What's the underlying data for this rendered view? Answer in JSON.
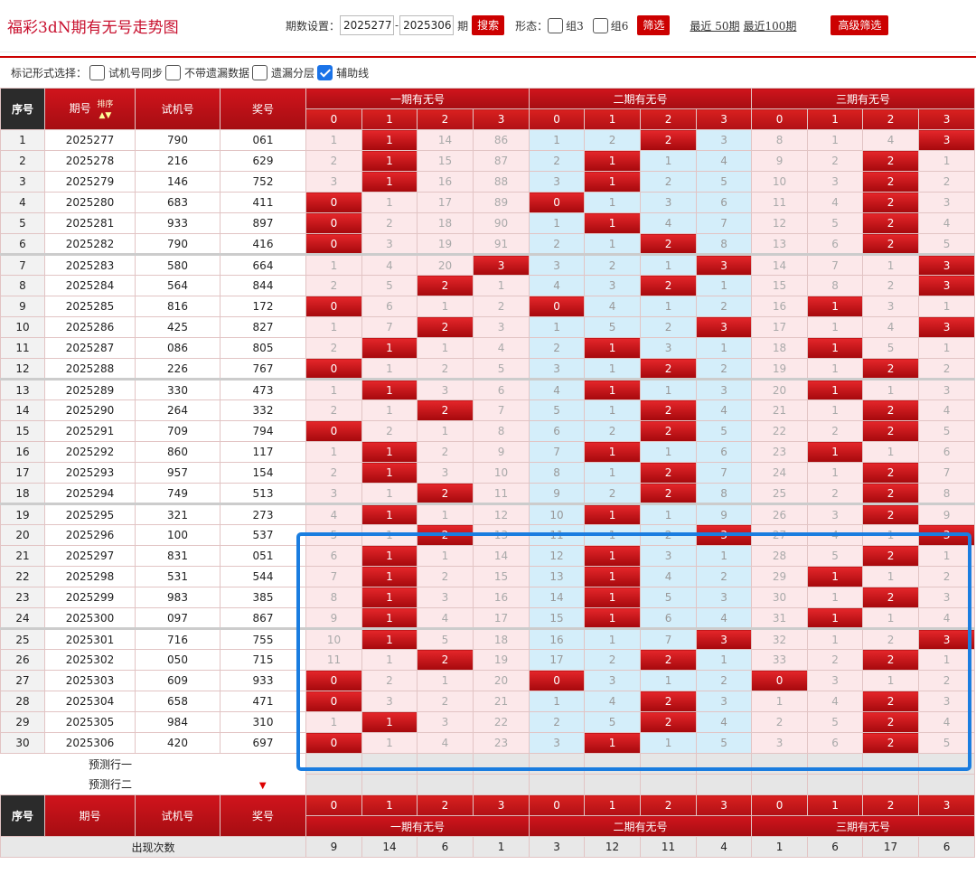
{
  "title": "福彩3dN期有无号走势图",
  "controls": {
    "period_label": "期数设置：",
    "from_value": "2025277",
    "dash": "-",
    "to_value": "2025306",
    "period_unit": "期",
    "search_label": "搜索",
    "form_label": "形态：",
    "group3_label": "组3",
    "group6_label": "组6",
    "filter_label": "筛选",
    "recent50_label": "最近 50期",
    "recent100_label": "最近100期",
    "advanced_label": "高级筛选"
  },
  "markbar": {
    "label": "标记形式选择：",
    "options": [
      {
        "label": "试机号同步",
        "checked": false
      },
      {
        "label": "不带遗漏数据",
        "checked": false
      },
      {
        "label": "遗漏分层",
        "checked": false
      },
      {
        "label": "辅助线",
        "checked": true
      }
    ]
  },
  "header": {
    "seq": "序号",
    "issue": "期号",
    "sort": "排序",
    "trial": "试机号",
    "prize": "奖号",
    "groups": [
      "一期有无号",
      "二期有无号",
      "三期有无号"
    ],
    "digits": [
      "0",
      "1",
      "2",
      "3"
    ]
  },
  "rows": [
    {
      "seq": "1",
      "issue": "2025277",
      "trial": "790",
      "prize": "061",
      "g": [
        [
          "1",
          "h1",
          "14",
          "86"
        ],
        [
          "1",
          "2",
          "h2",
          "3"
        ],
        [
          "8",
          "1",
          "4",
          "h3"
        ]
      ]
    },
    {
      "seq": "2",
      "issue": "2025278",
      "trial": "216",
      "prize": "629",
      "g": [
        [
          "2",
          "h1",
          "15",
          "87"
        ],
        [
          "2",
          "h1",
          "1",
          "4"
        ],
        [
          "9",
          "2",
          "h2",
          "1"
        ]
      ]
    },
    {
      "seq": "3",
      "issue": "2025279",
      "trial": "146",
      "prize": "752",
      "g": [
        [
          "3",
          "h1",
          "16",
          "88"
        ],
        [
          "3",
          "h1",
          "2",
          "5"
        ],
        [
          "10",
          "3",
          "h2",
          "2"
        ]
      ]
    },
    {
      "seq": "4",
      "issue": "2025280",
      "trial": "683",
      "prize": "411",
      "g": [
        [
          "h0",
          "1",
          "17",
          "89"
        ],
        [
          "h0",
          "1",
          "3",
          "6"
        ],
        [
          "11",
          "4",
          "h2",
          "3"
        ]
      ]
    },
    {
      "seq": "5",
      "issue": "2025281",
      "trial": "933",
      "prize": "897",
      "g": [
        [
          "h0",
          "2",
          "18",
          "90"
        ],
        [
          "1",
          "h1",
          "4",
          "7"
        ],
        [
          "12",
          "5",
          "h2",
          "4"
        ]
      ]
    },
    {
      "seq": "6",
      "issue": "2025282",
      "trial": "790",
      "prize": "416",
      "g": [
        [
          "h0",
          "3",
          "19",
          "91"
        ],
        [
          "2",
          "1",
          "h2",
          "8"
        ],
        [
          "13",
          "6",
          "h2",
          "5"
        ]
      ]
    },
    {
      "seq": "7",
      "issue": "2025283",
      "trial": "580",
      "prize": "664",
      "g": [
        [
          "1",
          "4",
          "20",
          "h3"
        ],
        [
          "3",
          "2",
          "1",
          "h3"
        ],
        [
          "14",
          "7",
          "1",
          "h3"
        ]
      ]
    },
    {
      "seq": "8",
      "issue": "2025284",
      "trial": "564",
      "prize": "844",
      "g": [
        [
          "2",
          "5",
          "h2",
          "1"
        ],
        [
          "4",
          "3",
          "h2",
          "1"
        ],
        [
          "15",
          "8",
          "2",
          "h3"
        ]
      ]
    },
    {
      "seq": "9",
      "issue": "2025285",
      "trial": "816",
      "prize": "172",
      "g": [
        [
          "h0",
          "6",
          "1",
          "2"
        ],
        [
          "h0",
          "4",
          "1",
          "2"
        ],
        [
          "16",
          "h1",
          "3",
          "1"
        ]
      ]
    },
    {
      "seq": "10",
      "issue": "2025286",
      "trial": "425",
      "prize": "827",
      "g": [
        [
          "1",
          "7",
          "h2",
          "3"
        ],
        [
          "1",
          "5",
          "2",
          "h3"
        ],
        [
          "17",
          "1",
          "4",
          "h3"
        ]
      ]
    },
    {
      "seq": "11",
      "issue": "2025287",
      "trial": "086",
      "prize": "805",
      "g": [
        [
          "2",
          "h1",
          "1",
          "4"
        ],
        [
          "2",
          "h1",
          "3",
          "1"
        ],
        [
          "18",
          "h1",
          "5",
          "1"
        ]
      ]
    },
    {
      "seq": "12",
      "issue": "2025288",
      "trial": "226",
      "prize": "767",
      "g": [
        [
          "h0",
          "1",
          "2",
          "5"
        ],
        [
          "3",
          "1",
          "h2",
          "2"
        ],
        [
          "19",
          "1",
          "h2",
          "2"
        ]
      ]
    },
    {
      "seq": "13",
      "issue": "2025289",
      "trial": "330",
      "prize": "473",
      "g": [
        [
          "1",
          "h1",
          "3",
          "6"
        ],
        [
          "4",
          "h1",
          "1",
          "3"
        ],
        [
          "20",
          "h1",
          "1",
          "3"
        ]
      ]
    },
    {
      "seq": "14",
      "issue": "2025290",
      "trial": "264",
      "prize": "332",
      "g": [
        [
          "2",
          "1",
          "h2",
          "7"
        ],
        [
          "5",
          "1",
          "h2",
          "4"
        ],
        [
          "21",
          "1",
          "h2",
          "4"
        ]
      ]
    },
    {
      "seq": "15",
      "issue": "2025291",
      "trial": "709",
      "prize": "794",
      "g": [
        [
          "h0",
          "2",
          "1",
          "8"
        ],
        [
          "6",
          "2",
          "h2",
          "5"
        ],
        [
          "22",
          "2",
          "h2",
          "5"
        ]
      ]
    },
    {
      "seq": "16",
      "issue": "2025292",
      "trial": "860",
      "prize": "117",
      "g": [
        [
          "1",
          "h1",
          "2",
          "9"
        ],
        [
          "7",
          "h1",
          "1",
          "6"
        ],
        [
          "23",
          "h1",
          "1",
          "6"
        ]
      ]
    },
    {
      "seq": "17",
      "issue": "2025293",
      "trial": "957",
      "prize": "154",
      "g": [
        [
          "2",
          "h1",
          "3",
          "10"
        ],
        [
          "8",
          "1",
          "h2",
          "7"
        ],
        [
          "24",
          "1",
          "h2",
          "7"
        ]
      ]
    },
    {
      "seq": "18",
      "issue": "2025294",
      "trial": "749",
      "prize": "513",
      "g": [
        [
          "3",
          "1",
          "h2",
          "11"
        ],
        [
          "9",
          "2",
          "h2",
          "8"
        ],
        [
          "25",
          "2",
          "h2",
          "8"
        ]
      ]
    },
    {
      "seq": "19",
      "issue": "2025295",
      "trial": "321",
      "prize": "273",
      "g": [
        [
          "4",
          "h1",
          "1",
          "12"
        ],
        [
          "10",
          "h1",
          "1",
          "9"
        ],
        [
          "26",
          "3",
          "h2",
          "9"
        ]
      ]
    },
    {
      "seq": "20",
      "issue": "2025296",
      "trial": "100",
      "prize": "537",
      "g": [
        [
          "5",
          "1",
          "h2",
          "13"
        ],
        [
          "11",
          "1",
          "2",
          "h3"
        ],
        [
          "27",
          "4",
          "1",
          "h3"
        ]
      ]
    },
    {
      "seq": "21",
      "issue": "2025297",
      "trial": "831",
      "prize": "051",
      "g": [
        [
          "6",
          "h1",
          "1",
          "14"
        ],
        [
          "12",
          "h1",
          "3",
          "1"
        ],
        [
          "28",
          "5",
          "h2",
          "1"
        ]
      ]
    },
    {
      "seq": "22",
      "issue": "2025298",
      "trial": "531",
      "prize": "544",
      "g": [
        [
          "7",
          "h1",
          "2",
          "15"
        ],
        [
          "13",
          "h1",
          "4",
          "2"
        ],
        [
          "29",
          "h1",
          "1",
          "2"
        ]
      ]
    },
    {
      "seq": "23",
      "issue": "2025299",
      "trial": "983",
      "prize": "385",
      "g": [
        [
          "8",
          "h1",
          "3",
          "16"
        ],
        [
          "14",
          "h1",
          "5",
          "3"
        ],
        [
          "30",
          "1",
          "h2",
          "3"
        ]
      ]
    },
    {
      "seq": "24",
      "issue": "2025300",
      "trial": "097",
      "prize": "867",
      "g": [
        [
          "9",
          "h1",
          "4",
          "17"
        ],
        [
          "15",
          "h1",
          "6",
          "4"
        ],
        [
          "31",
          "h1",
          "1",
          "4"
        ]
      ]
    },
    {
      "seq": "25",
      "issue": "2025301",
      "trial": "716",
      "prize": "755",
      "g": [
        [
          "10",
          "h1",
          "5",
          "18"
        ],
        [
          "16",
          "1",
          "7",
          "h3"
        ],
        [
          "32",
          "1",
          "2",
          "h3"
        ]
      ]
    },
    {
      "seq": "26",
      "issue": "2025302",
      "trial": "050",
      "prize": "715",
      "g": [
        [
          "11",
          "1",
          "h2",
          "19"
        ],
        [
          "17",
          "2",
          "h2",
          "1"
        ],
        [
          "33",
          "2",
          "h2",
          "1"
        ]
      ]
    },
    {
      "seq": "27",
      "issue": "2025303",
      "trial": "609",
      "prize": "933",
      "g": [
        [
          "h0",
          "2",
          "1",
          "20"
        ],
        [
          "h0",
          "3",
          "1",
          "2"
        ],
        [
          "h0",
          "3",
          "1",
          "2"
        ]
      ]
    },
    {
      "seq": "28",
      "issue": "2025304",
      "trial": "658",
      "prize": "471",
      "g": [
        [
          "h0",
          "3",
          "2",
          "21"
        ],
        [
          "1",
          "4",
          "h2",
          "3"
        ],
        [
          "1",
          "4",
          "h2",
          "3"
        ]
      ]
    },
    {
      "seq": "29",
      "issue": "2025305",
      "trial": "984",
      "prize": "310",
      "g": [
        [
          "1",
          "h1",
          "3",
          "22"
        ],
        [
          "2",
          "5",
          "h2",
          "4"
        ],
        [
          "2",
          "5",
          "h2",
          "4"
        ]
      ]
    },
    {
      "seq": "30",
      "issue": "2025306",
      "trial": "420",
      "prize": "697",
      "g": [
        [
          "h0",
          "1",
          "4",
          "23"
        ],
        [
          "3",
          "h1",
          "1",
          "5"
        ],
        [
          "3",
          "6",
          "h2",
          "5"
        ]
      ]
    }
  ],
  "predict": [
    "预测行一",
    "预测行二"
  ],
  "footer": {
    "seq": "序号",
    "issue": "期号",
    "trial": "试机号",
    "prize": "奖号",
    "groups": [
      "一期有无号",
      "二期有无号",
      "三期有无号"
    ],
    "digits": [
      "0",
      "1",
      "2",
      "3"
    ]
  },
  "stats": {
    "label": "出现次数",
    "values": [
      "9",
      "14",
      "6",
      "1",
      "3",
      "12",
      "11",
      "4",
      "1",
      "6",
      "17",
      "6"
    ]
  }
}
